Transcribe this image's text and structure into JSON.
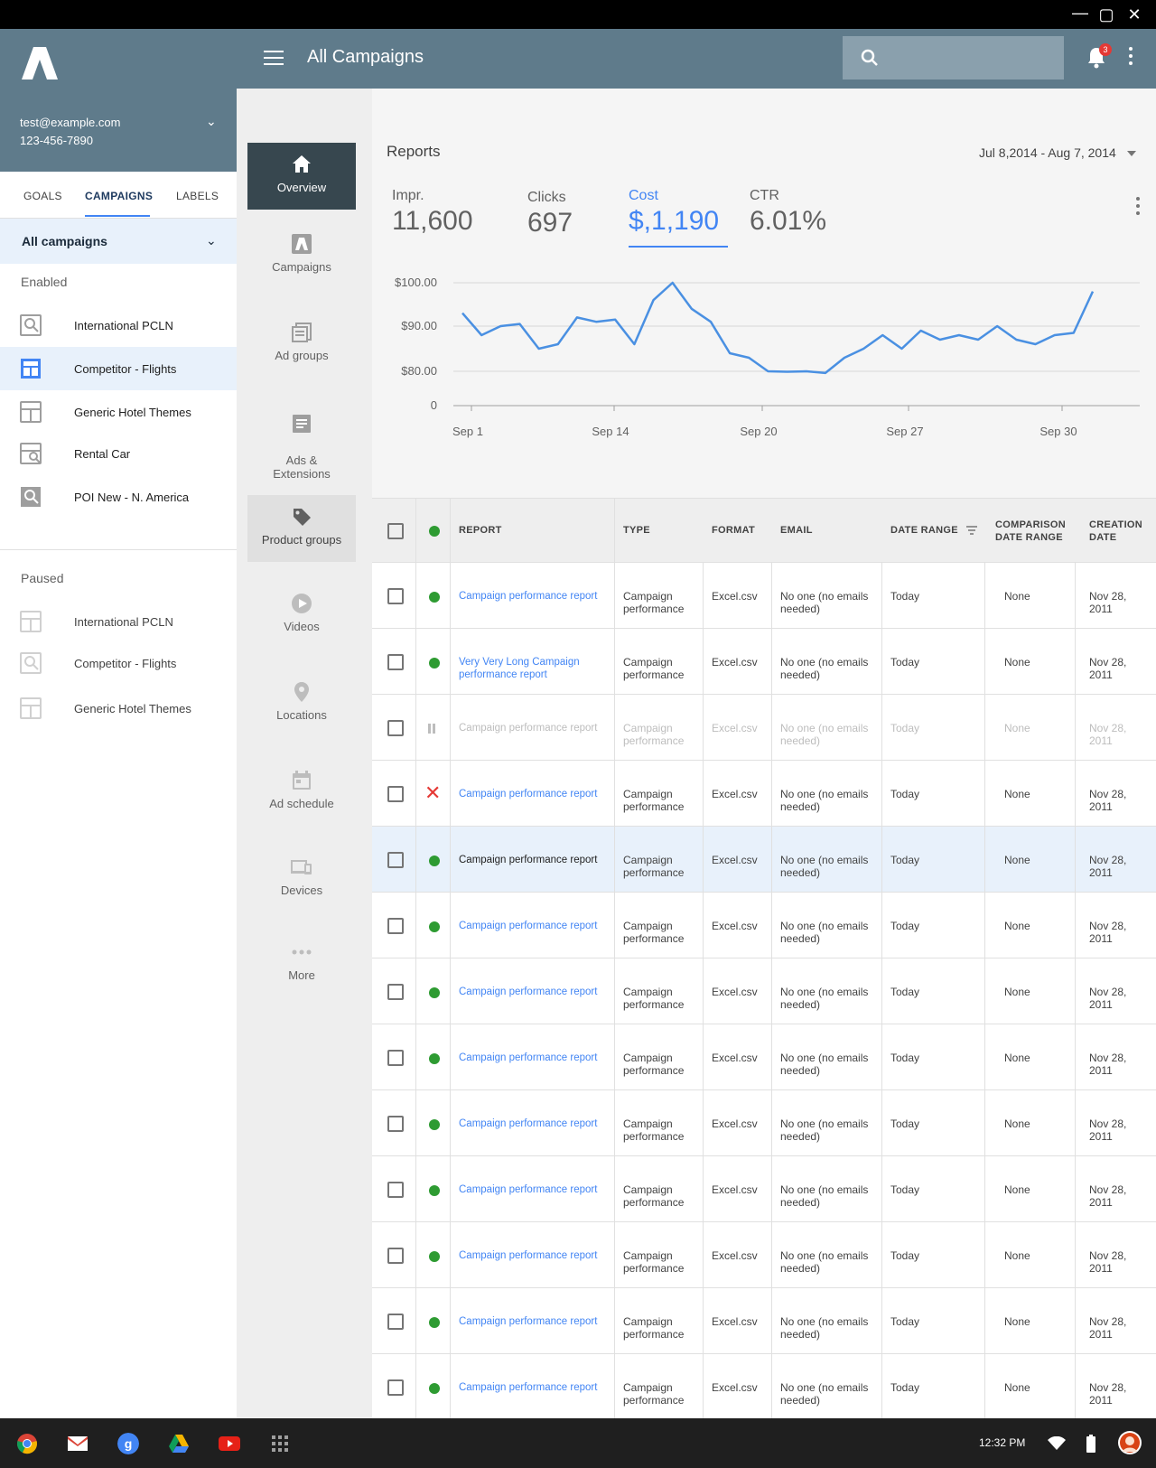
{
  "window": {
    "minimize": "—",
    "maximize": "▢",
    "close": "✕"
  },
  "account": {
    "email": "test@example.com",
    "phone": "123-456-7890"
  },
  "left_tabs": [
    "GOALS",
    "CAMPAIGNS",
    "LABELS"
  ],
  "campaign_filter": "All campaigns",
  "enabled_title": "Enabled",
  "enabled": [
    {
      "label": "International PCLN",
      "icon": "search-icon"
    },
    {
      "label": "Competitor - Flights",
      "icon": "dashboard-icon"
    },
    {
      "label": "Generic Hotel Themes",
      "icon": "dashboard-icon"
    },
    {
      "label": "Rental Car",
      "icon": "search-icon"
    },
    {
      "label": "POI New - N. America",
      "icon": "search-icon"
    }
  ],
  "paused_title": "Paused",
  "paused": [
    {
      "label": "International PCLN",
      "icon": "dashboard-icon"
    },
    {
      "label": "Competitor - Flights",
      "icon": "search-icon"
    },
    {
      "label": "Generic Hotel Themes",
      "icon": "dashboard-icon"
    }
  ],
  "topbar": {
    "title": "All Campaigns",
    "notification_count": "3"
  },
  "nav": [
    {
      "label": "Overview",
      "icon": "home-icon"
    },
    {
      "label": "Campaigns",
      "icon": "campaigns-icon"
    },
    {
      "label": "Ad groups",
      "icon": "ad-groups-icon"
    },
    {
      "label": "Ads &\nExtensions",
      "icon": "ads-icon"
    },
    {
      "label": "Product groups",
      "icon": "tag-icon"
    },
    {
      "label": "Videos",
      "icon": "play-icon"
    },
    {
      "label": "Locations",
      "icon": "location-icon"
    },
    {
      "label": "Ad schedule",
      "icon": "calendar-icon"
    },
    {
      "label": "Devices",
      "icon": "devices-icon"
    },
    {
      "label": "More",
      "icon": "more-icon"
    }
  ],
  "reports": {
    "title": "Reports",
    "date_range": "Jul 8,2014 - Aug 7, 2014",
    "stats": [
      {
        "label": "Impr.",
        "value": "11,600"
      },
      {
        "label": "Clicks",
        "value": "697"
      },
      {
        "label": "Cost",
        "value": "$,1,190"
      },
      {
        "label": "CTR",
        "value": "6.01%"
      }
    ]
  },
  "chart_data": {
    "type": "line",
    "y_ticks": [
      "$100.00",
      "$90.00",
      "$80.00",
      "0"
    ],
    "x_ticks": [
      "Sep 1",
      "Sep 14",
      "Sep 20",
      "Sep 27",
      "Sep 30"
    ],
    "series": [
      {
        "values": [
          93,
          88,
          90,
          90.5,
          85,
          86,
          92,
          91,
          91.5,
          86,
          96,
          100,
          94,
          91,
          84,
          83,
          80,
          79,
          80,
          76,
          83,
          85,
          88,
          85,
          89,
          87,
          88,
          87,
          90,
          87,
          86,
          88,
          88.5,
          98
        ]
      }
    ],
    "color": "#4a90e2"
  },
  "table": {
    "headers": [
      "REPORT",
      "TYPE",
      "FORMAT",
      "EMAIL",
      "DATE RANGE",
      "COMPARISON DATE RANGE",
      "CREATION DATE"
    ],
    "rows": [
      {
        "status": "enabled",
        "report": "Campaign performance report",
        "type": "Campaign performance",
        "format": "Excel.csv",
        "email": "No one (no emails needed)",
        "date_range": "Today",
        "comparison": "None",
        "created": "Nov 28, 2011"
      },
      {
        "status": "enabled",
        "report": "Very Very Long Campaign performance report",
        "type": "Campaign performance",
        "format": "Excel.csv",
        "email": "No one (no emails needed)",
        "date_range": "Today",
        "comparison": "None",
        "created": "Nov 28, 2011"
      },
      {
        "status": "paused",
        "report": "Campaign performance report",
        "type": "Campaign performance",
        "format": "Excel.csv",
        "email": "No one (no emails needed)",
        "date_range": "Today",
        "comparison": "None",
        "created": "Nov 28, 2011"
      },
      {
        "status": "error",
        "report": "Campaign performance report",
        "type": "Campaign performance",
        "format": "Excel.csv",
        "email": "No one (no emails needed)",
        "date_range": "Today",
        "comparison": "None",
        "created": "Nov 28, 2011"
      },
      {
        "status": "enabled",
        "report": "Campaign performance report",
        "type": "Campaign performance",
        "format": "Excel.csv",
        "email": "No one (no emails needed)",
        "date_range": "Today",
        "comparison": "None",
        "created": "Nov 28, 2011"
      },
      {
        "status": "enabled",
        "report": "Campaign performance report",
        "type": "Campaign performance",
        "format": "Excel.csv",
        "email": "No one (no emails needed)",
        "date_range": "Today",
        "comparison": "None",
        "created": "Nov 28, 2011"
      },
      {
        "status": "enabled",
        "report": "Campaign performance report",
        "type": "Campaign performance",
        "format": "Excel.csv",
        "email": "No one (no emails needed)",
        "date_range": "Today",
        "comparison": "None",
        "created": "Nov 28, 2011"
      },
      {
        "status": "enabled",
        "report": "Campaign performance report",
        "type": "Campaign performance",
        "format": "Excel.csv",
        "email": "No one (no emails needed)",
        "date_range": "Today",
        "comparison": "None",
        "created": "Nov 28, 2011"
      },
      {
        "status": "enabled",
        "report": "Campaign performance report",
        "type": "Campaign performance",
        "format": "Excel.csv",
        "email": "No one (no emails needed)",
        "date_range": "Today",
        "comparison": "None",
        "created": "Nov 28, 2011"
      },
      {
        "status": "enabled",
        "report": "Campaign performance report",
        "type": "Campaign performance",
        "format": "Excel.csv",
        "email": "No one (no emails needed)",
        "date_range": "Today",
        "comparison": "None",
        "created": "Nov 28, 2011"
      },
      {
        "status": "enabled",
        "report": "Campaign performance report",
        "type": "Campaign performance",
        "format": "Excel.csv",
        "email": "No one (no emails needed)",
        "date_range": "Today",
        "comparison": "None",
        "created": "Nov 28, 2011"
      },
      {
        "status": "enabled",
        "report": "Campaign performance report",
        "type": "Campaign performance",
        "format": "Excel.csv",
        "email": "No one (no emails needed)",
        "date_range": "Today",
        "comparison": "None",
        "created": "Nov 28, 2011"
      },
      {
        "status": "enabled",
        "report": "Campaign performance report",
        "type": "Campaign performance",
        "format": "Excel.csv",
        "email": "No one (no emails needed)",
        "date_range": "Today",
        "comparison": "None",
        "created": "Nov 28, 2011"
      }
    ]
  },
  "taskbar": {
    "apps": [
      "chrome-icon",
      "gmail-icon",
      "google-plus-icon",
      "drive-icon",
      "youtube-icon",
      "app-launcher-icon"
    ],
    "clock": "12:32 PM"
  }
}
